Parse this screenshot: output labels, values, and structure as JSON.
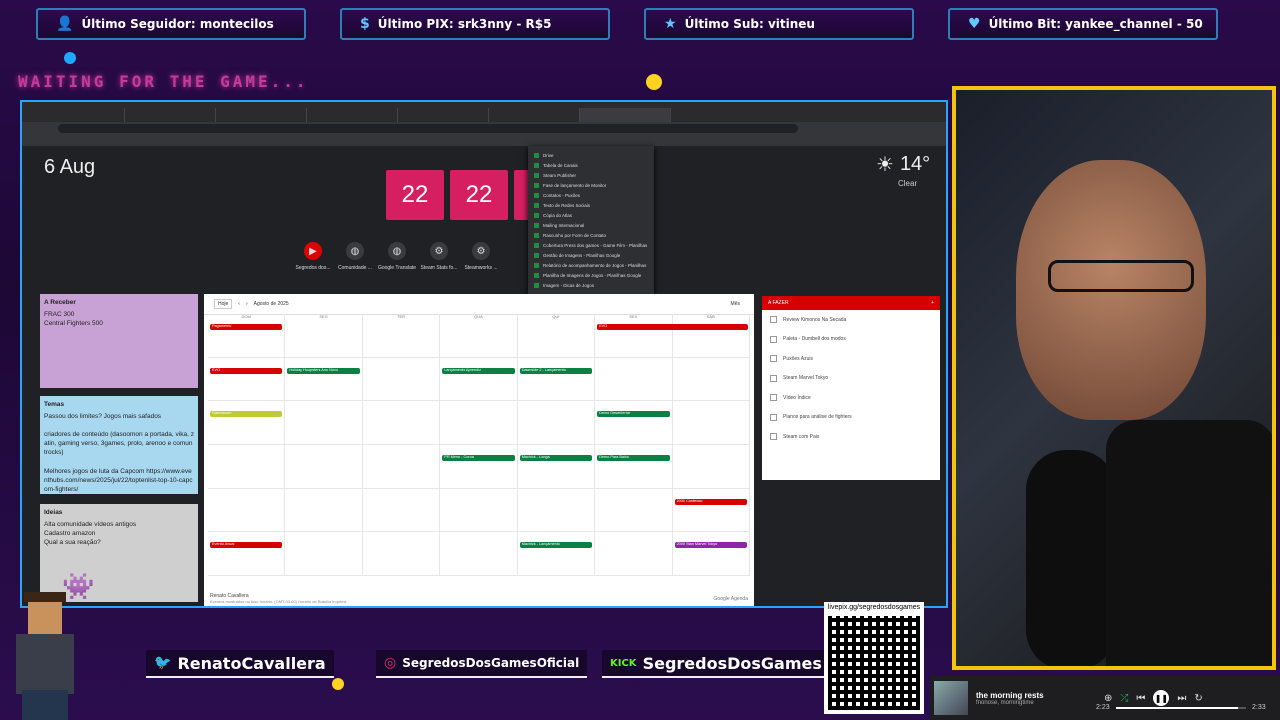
{
  "ticker": [
    {
      "icon": "user-icon",
      "text": "Último Seguidor: montecilos"
    },
    {
      "icon": "dollar-icon",
      "text": "Último PIX: srk3nny - R$5"
    },
    {
      "icon": "star-icon",
      "text": "Último Sub: vitineu"
    },
    {
      "icon": "heart-icon",
      "text": "Último Bit: yankee_channel - 50"
    }
  ],
  "waiting": "WAITING FOR THE GAME...",
  "browser": {
    "date": "6 Aug",
    "clock": [
      "22",
      "22"
    ],
    "weather": {
      "temp": "14°",
      "desc": "Clear"
    },
    "shortcuts": [
      "Segredos dos...",
      "Comunidade ...",
      "Google Translate",
      "Steam Stats fo...",
      "Steamworks ..."
    ],
    "dropdown": [
      "Drive",
      "Tabela de Canais",
      "Steam Publisher",
      "Fase de lançamento de Monitor",
      "Contatos - Puxões",
      "Texto de Redes Sociais",
      "Cópia do Atlas",
      "Mailing Internacional",
      "Rascunho por Form de Contato",
      "Cobertura Press dos games - Game Film - Planilhas",
      "Gestão de Imagens - Planilhas Google",
      "Relatório de acompanhamento de Jogos - Planilhas",
      "Planilha de Imagens de Jogos - Planilhas Google",
      "Imagem - Dicas de Jogos"
    ],
    "notes": [
      {
        "title": "A Receber",
        "body": "FRAC 300\nCentral Fighters 500",
        "color": "#c8a2d4"
      },
      {
        "title": "Temas",
        "body": "Passou dos limites? Jogos mais safados\n\ncriadores de conteúdo (dasoomon a portada, vika, zatin, gaming verso, 3games, prolo, arenoo e comuntrocks)\n\nMelhores jogos de luta da Capcom https://www.eventhubs.com/news/2025/jul/22/toptenlist-top-10-capcom-fighters/",
        "color": "#a8d8f0"
      },
      {
        "title": "Ideias",
        "body": "Alta comunidade vídeos antigos\nCadastro amazon\nQual a sua reação?",
        "color": "#cfcfcf"
      }
    ],
    "calendar": {
      "month": "Agosto de 2025",
      "today_btn": "Hoje",
      "view": "Mês",
      "days": [
        "DOM",
        "SEG",
        "TER",
        "QUA",
        "QUI",
        "SEX",
        "SÁB"
      ],
      "owner": "Renato Cavallera",
      "footer": "Eventos mostrados no fuso horário: (GMT-03:00) Horário de Brasília  Imprimir",
      "brand": "Google Agenda",
      "events": [
        {
          "row": 0,
          "col": 0,
          "span": 1,
          "color": "red",
          "text": "Pagamento"
        },
        {
          "row": 0,
          "col": 5,
          "span": 2,
          "color": "red",
          "text": "EVO"
        },
        {
          "row": 1,
          "col": 0,
          "span": 1,
          "color": "red",
          "text": "EVO"
        },
        {
          "row": 1,
          "col": 1,
          "span": 1,
          "color": "green",
          "text": "Holiday Hoopsters Ano Novo"
        },
        {
          "row": 1,
          "col": 3,
          "span": 1,
          "color": "green",
          "text": "Lançamento Aprendiz"
        },
        {
          "row": 1,
          "col": 4,
          "span": 1,
          "color": "green",
          "text": "Dawnside 2 - Lançamento"
        },
        {
          "row": 2,
          "col": 0,
          "span": 1,
          "color": "olive",
          "text": "Gamescom"
        },
        {
          "row": 2,
          "col": 5,
          "span": 1,
          "color": "green",
          "text": "Demo Desenterrar"
        },
        {
          "row": 3,
          "col": 3,
          "span": 1,
          "color": "green",
          "text": "PR Menu - Coroa"
        },
        {
          "row": 3,
          "col": 4,
          "span": 1,
          "color": "green",
          "text": "Machick - Longa"
        },
        {
          "row": 3,
          "col": 5,
          "span": 1,
          "color": "green",
          "text": "Demo Para Baixo"
        },
        {
          "row": 4,
          "col": 6,
          "span": 1,
          "color": "red",
          "text": "2000 Conteúdo"
        },
        {
          "row": 5,
          "col": 0,
          "span": 1,
          "color": "red",
          "text": "Evento Anual"
        },
        {
          "row": 5,
          "col": 4,
          "span": 1,
          "color": "green",
          "text": "Machick - Lançamento"
        },
        {
          "row": 5,
          "col": 6,
          "span": 1,
          "color": "purple",
          "text": "2000 Stan Marvel Tokyo"
        }
      ]
    },
    "todo": {
      "title": "A FAZER",
      "items": [
        "Review Kimonos Na Secada",
        "Paleta - Dumbell dos modos",
        "Puxões Azuis",
        "Steam Marvel Tokyo",
        "Vídeo Índice",
        "Planos para análise de fighters",
        "Steam com Pais"
      ]
    }
  },
  "social": [
    {
      "icon": "twitter-icon",
      "glyph": "🐦",
      "label": "RenatoCavallera"
    },
    {
      "icon": "instagram-icon",
      "glyph": "◎",
      "label": "SegredosDosGamesOficial"
    },
    {
      "icon": "kick-icon",
      "glyph": "KICK",
      "label": "SegredosDosGames"
    }
  ],
  "qr": {
    "url": "livepix.gg/segredosdosgames"
  },
  "player": {
    "title": "the morning rests",
    "artist": "fnonose, morningtime",
    "elapsed": "2:23",
    "total": "2:33",
    "progress": 0.94
  },
  "colors": {
    "accent": "#2aa5ff",
    "camera_border": "#f2c40f",
    "flip": "#d61f60"
  }
}
